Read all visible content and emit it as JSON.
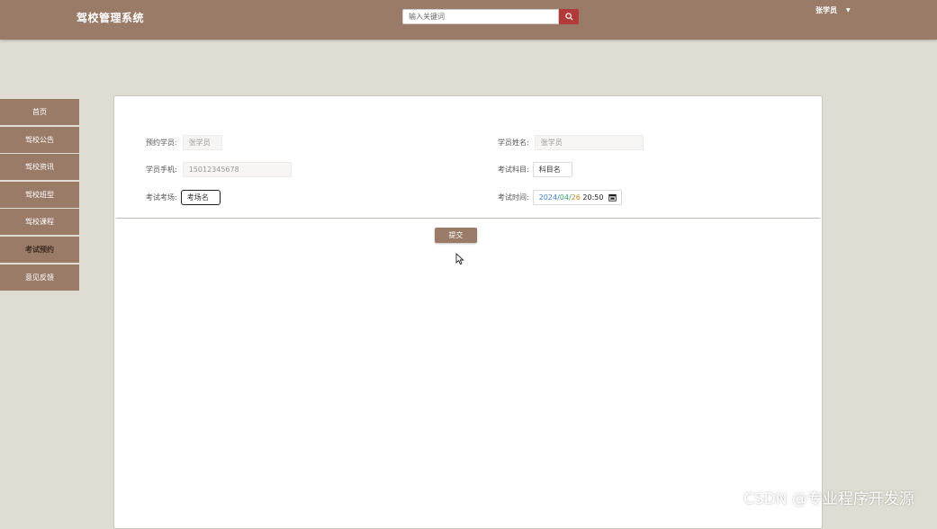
{
  "header": {
    "app_title": "驾校管理系统",
    "search_placeholder": "输入关键词",
    "user_name": "张学员",
    "user_caret": "▼"
  },
  "sidebar": {
    "items": [
      {
        "label": "首页"
      },
      {
        "label": "驾校公告"
      },
      {
        "label": "驾校资讯"
      },
      {
        "label": "驾校班型"
      },
      {
        "label": "驾校课程"
      },
      {
        "label": "考试预约",
        "active": true
      },
      {
        "label": "意见反馈"
      }
    ]
  },
  "form": {
    "reserved_student": {
      "label": "预约学员:",
      "value": "张学员"
    },
    "student_phone": {
      "label": "学员手机:",
      "value": "15012345678"
    },
    "exam_venue": {
      "label": "考试考场:",
      "value": "考场名"
    },
    "student_name": {
      "label": "学员姓名:",
      "value": "张学员"
    },
    "exam_subject": {
      "label": "考试科目:",
      "value": "科目名"
    },
    "exam_time": {
      "label": "考试时间:",
      "year": "2024",
      "month": "04",
      "day": "26",
      "time": "20:50"
    },
    "submit_label": "提交"
  },
  "watermark": "CSDN @专业程序开发源",
  "colors": {
    "brand": "#9a7b68",
    "background": "#dfddd3",
    "search_button": "#b23a3a"
  }
}
